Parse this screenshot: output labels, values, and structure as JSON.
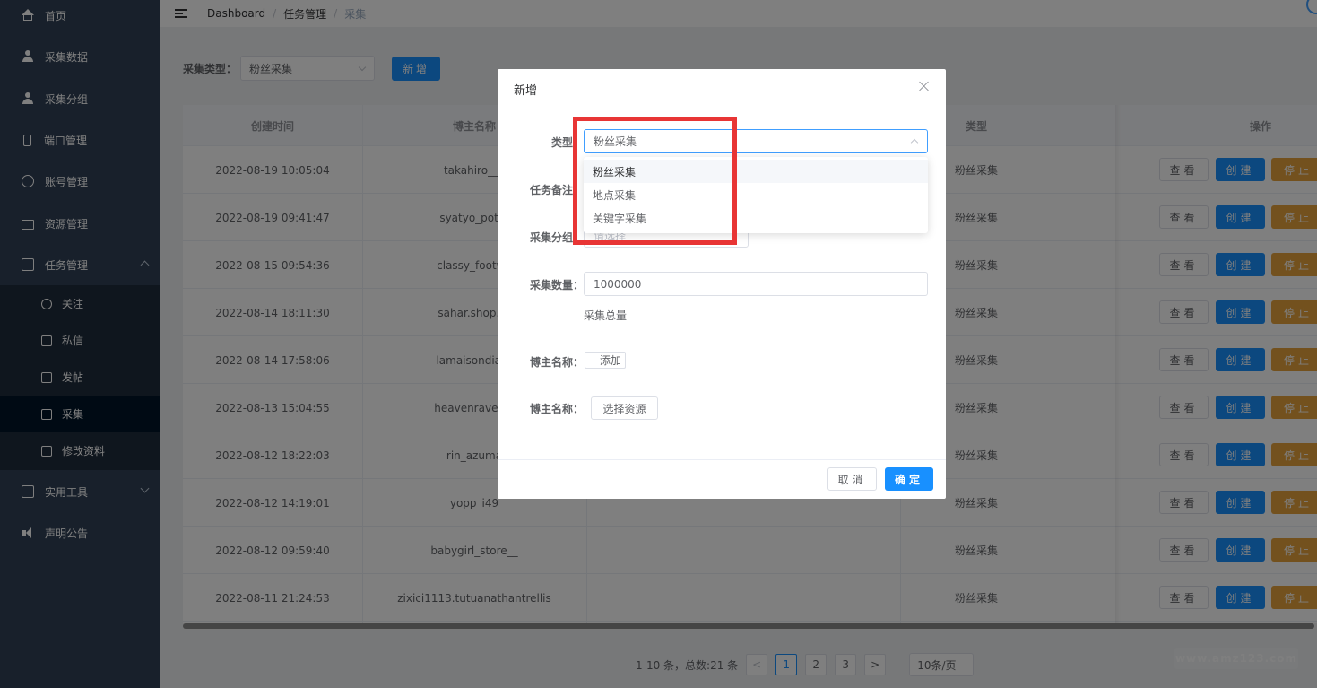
{
  "sidebar": {
    "items": [
      {
        "label": "首页",
        "icon": "home-icon"
      },
      {
        "label": "采集数据",
        "icon": "user-icon"
      },
      {
        "label": "采集分组",
        "icon": "user-icon"
      },
      {
        "label": "端口管理",
        "icon": "phone-icon"
      },
      {
        "label": "账号管理",
        "icon": "account-icon"
      },
      {
        "label": "资源管理",
        "icon": "folder-icon"
      },
      {
        "label": "任务管理",
        "icon": "task-icon"
      },
      {
        "label": "实用工具",
        "icon": "toolbox-icon"
      },
      {
        "label": "声明公告",
        "icon": "speaker-icon"
      }
    ],
    "submenu": [
      {
        "label": "关注",
        "icon": "heart-icon"
      },
      {
        "label": "私信",
        "icon": "message-icon"
      },
      {
        "label": "发帖",
        "icon": "mail-icon"
      },
      {
        "label": "采集",
        "icon": "document-icon"
      },
      {
        "label": "修改资料",
        "icon": "edit-icon"
      }
    ]
  },
  "breadcrumb": [
    "Dashboard",
    "任务管理",
    "采集"
  ],
  "filter": {
    "label": "采集类型：",
    "value": "粉丝采集",
    "add_button": "新增"
  },
  "table": {
    "headers": [
      "创建时间",
      "博主名称",
      "类型",
      "操作"
    ],
    "actions": {
      "view": "查看",
      "create": "创建",
      "stop": "停止"
    },
    "rows": [
      {
        "time": "2022-08-19 10:05:04",
        "name": "takahiro__k",
        "type": "粉丝采集"
      },
      {
        "time": "2022-08-19 09:41:47",
        "name": "syatyo_potty",
        "type": "粉丝采集"
      },
      {
        "time": "2022-08-15 09:54:36",
        "name": "classy_footwe",
        "type": "粉丝采集"
      },
      {
        "time": "2022-08-14 18:11:30",
        "name": "sahar.shop.tu",
        "type": "粉丝采集"
      },
      {
        "time": "2022-08-14 17:58:06",
        "name": "lamaisondiadr",
        "type": "粉丝采集"
      },
      {
        "time": "2022-08-13 15:04:55",
        "name": "heavenravenol",
        "type": "粉丝采集"
      },
      {
        "time": "2022-08-12 18:22:03",
        "name": "rin_azuma",
        "type": "粉丝采集"
      },
      {
        "time": "2022-08-12 14:19:01",
        "name": "yopp_i49",
        "type": "粉丝采集"
      },
      {
        "time": "2022-08-12 09:59:40",
        "name": "babygirl_store__",
        "type": "粉丝采集"
      },
      {
        "time": "2022-08-11 21:24:53",
        "name": "zixici1113.tutuanathantrellis",
        "type": "粉丝采集"
      }
    ]
  },
  "pagination": {
    "summary": "1-10 条，总数:21 条",
    "pages": [
      "1",
      "2",
      "3"
    ],
    "prev": "<",
    "next": ">",
    "page_size": "10条/页"
  },
  "watermark": "www.amz123.com",
  "dialog": {
    "title": "新增",
    "type_label": "类型",
    "type_value": "粉丝采集",
    "remark_label": "任务备注",
    "group_label": "采集分组",
    "group_placeholder": "请选择",
    "count_label": "采集数量：",
    "count_value": "1000000",
    "count_hint": "采集总量",
    "blogger_label_1": "博主名称：",
    "add_button": "添加",
    "blogger_label_2": "博主名称：",
    "select_resource_button": "选择资源",
    "cancel": "取消",
    "confirm": "确定"
  },
  "dropdown": {
    "options": [
      "粉丝采集",
      "地点采集",
      "关键字采集"
    ]
  },
  "colors": {
    "sidebar": "#304156",
    "primary": "#1890ff",
    "warning": "#e6a23c",
    "highlight": "#e83535"
  }
}
